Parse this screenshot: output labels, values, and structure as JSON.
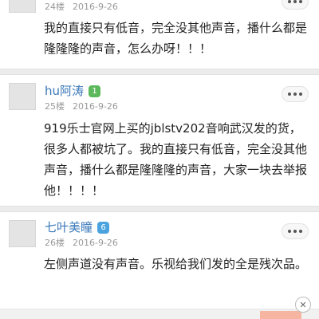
{
  "posts": [
    {
      "floor": "24楼",
      "date": "2016-9-26",
      "content": "我的直接只有低音，完全没其他声音，播什么都是隆隆隆的声音，怎么办呀！！！"
    },
    {
      "username": "hu阿涛",
      "level": "1",
      "level_color": "#5cb85c",
      "floor": "25楼",
      "date": "2016-9-26",
      "content": "919乐士官网上买的jblstv202音响武汉发的货，很多人都被坑了。我的直接只有低音，完全没其他声音，播什么都是隆隆隆的声音，大家一块去举报他！！！！"
    },
    {
      "username": "七叶美瞳",
      "level": "6",
      "level_color": "#4aa3df",
      "floor": "26楼",
      "date": "2016-9-26",
      "content": "左侧声道没有声音。乐视给我们发的全是残次品。"
    }
  ],
  "close_glyph": "✕"
}
